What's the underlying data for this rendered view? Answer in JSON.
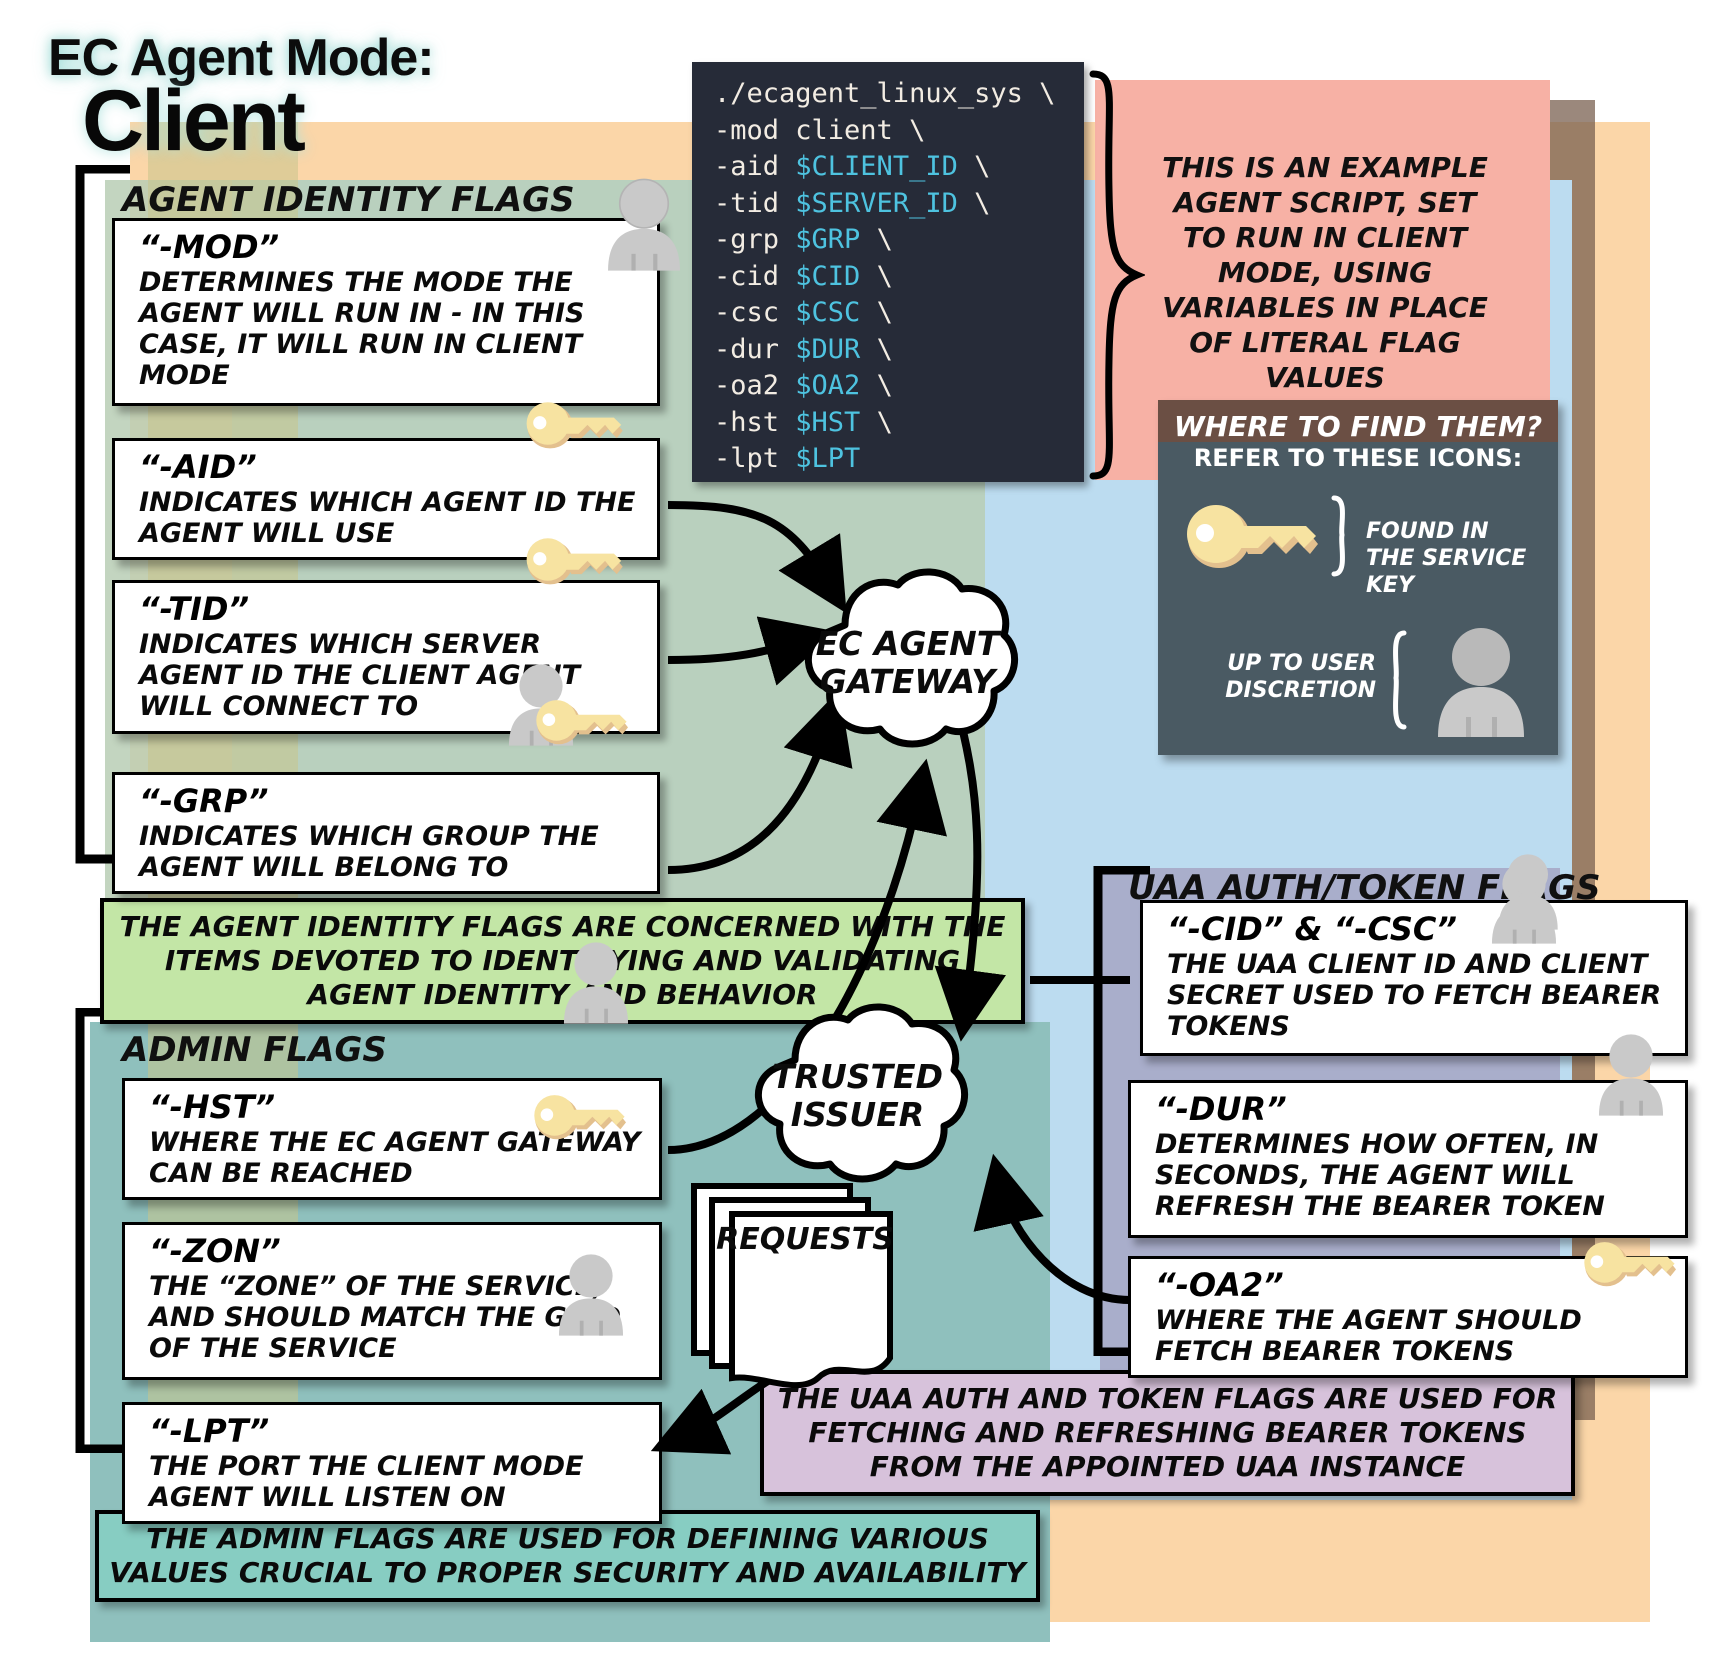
{
  "title": {
    "line1": "EC Agent Mode:",
    "line2": "Client"
  },
  "code_block": {
    "lines": [
      {
        "cmd": "./ecagent_linux_sys \\",
        "var": ""
      },
      {
        "cmd": "-mod client \\",
        "var": ""
      },
      {
        "cmd": "-aid ",
        "var": "$CLIENT_ID",
        "tail": " \\"
      },
      {
        "cmd": "-tid ",
        "var": "$SERVER_ID",
        "tail": " \\"
      },
      {
        "cmd": "-grp ",
        "var": "$GRP",
        "tail": " \\"
      },
      {
        "cmd": "-cid ",
        "var": "$CID",
        "tail": " \\"
      },
      {
        "cmd": "-csc ",
        "var": "$CSC",
        "tail": " \\"
      },
      {
        "cmd": "-dur ",
        "var": "$DUR",
        "tail": " \\"
      },
      {
        "cmd": "-oa2 ",
        "var": "$OA2",
        "tail": " \\"
      },
      {
        "cmd": "-hst ",
        "var": "$HST",
        "tail": " \\"
      },
      {
        "cmd": "-lpt ",
        "var": "$LPT",
        "tail": ""
      }
    ],
    "bg_color": "#262b38",
    "text_color": "#f2ece3",
    "var_color": "#4ec3e0"
  },
  "pink_note": {
    "text": "THIS IS AN EXAMPLE AGENT SCRIPT, SET TO RUN IN CLIENT MODE, USING VARIABLES IN PLACE OF LITERAL FLAG VALUES",
    "bg_color": "#f7b1a5"
  },
  "find_box": {
    "title": "WHERE TO FIND THEM?",
    "subtitle": "REFER TO THESE ICONS:",
    "key_label": "FOUND IN THE SERVICE KEY",
    "user_label": "UP TO USER DISCRETION",
    "bg_color": "#4a5a63",
    "header_color": "#6b4f44"
  },
  "sections": {
    "agent_identity": {
      "label": "AGENT IDENTITY FLAGS",
      "caption": "THE AGENT IDENTITY FLAGS ARE CONCERNED WITH THE ITEMS DEVOTED TO IDENTIFYING AND VALIDATING AGENT IDENTITY AND BEHAVIOR",
      "caption_color": "#c3e6a6",
      "cards": [
        {
          "flag": "“-MOD”",
          "desc": "DETERMINES THE MODE THE AGENT WILL RUN IN - IN THIS CASE, IT WILL RUN IN CLIENT MODE",
          "icons": [
            "user"
          ]
        },
        {
          "flag": "“-AID”",
          "desc": "INDICATES WHICH AGENT ID THE AGENT WILL USE",
          "icons": [
            "key"
          ]
        },
        {
          "flag": "“-TID”",
          "desc": "INDICATES WHICH SERVER AGENT ID THE CLIENT AGENT WILL CONNECT TO",
          "icons": [
            "key"
          ]
        },
        {
          "flag": "“-GRP”",
          "desc": "INDICATES WHICH GROUP THE AGENT WILL BELONG TO",
          "icons": [
            "user",
            "key"
          ]
        }
      ]
    },
    "admin": {
      "label": "ADMIN FLAGS",
      "caption": "THE ADMIN FLAGS ARE USED FOR DEFINING VARIOUS VALUES CRUCIAL TO PROPER SECURITY AND AVAILABILITY",
      "caption_color": "#87cdc2",
      "cards": [
        {
          "flag": "“-HST”",
          "desc": "WHERE THE EC AGENT GATEWAY CAN BE REACHED",
          "icons": [
            "user"
          ]
        },
        {
          "flag": "“-ZON”",
          "desc": "THE “ZONE” OF THE SERVICE, AND SHOULD MATCH THE GUID OF THE SERVICE",
          "icons": [
            "key"
          ]
        },
        {
          "flag": "“-LPT”",
          "desc": "THE PORT THE CLIENT MODE AGENT WILL LISTEN ON",
          "icons": [
            "user"
          ]
        }
      ]
    },
    "uaa": {
      "label": "UAA AUTH/TOKEN FLAGS",
      "caption": "THE UAA AUTH AND TOKEN FLAGS ARE USED FOR FETCHING AND REFRESHING BEARER TOKENS FROM THE APPOINTED UAA INSTANCE",
      "caption_color": "#d7c2db",
      "cards": [
        {
          "flag": "“-CID” & “-CSC”",
          "desc": "THE UAA CLIENT ID AND CLIENT SECRET USED TO FETCH BEARER TOKENS",
          "icons": [
            "user"
          ]
        },
        {
          "flag": "“-DUR”",
          "desc": "DETERMINES HOW OFTEN, IN SECONDS, THE AGENT WILL REFRESH THE BEARER TOKEN",
          "icons": [
            "user"
          ]
        },
        {
          "flag": "“-OA2”",
          "desc": "WHERE THE AGENT SHOULD FETCH BEARER TOKENS",
          "icons": [
            "key"
          ]
        }
      ]
    }
  },
  "nodes": {
    "gateway": "EC AGENT GATEWAY",
    "issuer": "TRUSTED ISSUER",
    "requests": "REQUESTS"
  },
  "colors": {
    "orange_panel": "#fbd6a8",
    "blue_panel": "#bcdcf0",
    "green_panel": "#b8ceb5",
    "teal_panel": "#8fc0bd",
    "purple_panel": "#a6a8c7",
    "brown_panel": "#7a6050",
    "key_icon": "#f7e3a1",
    "user_icon": "#c9c9c9"
  }
}
